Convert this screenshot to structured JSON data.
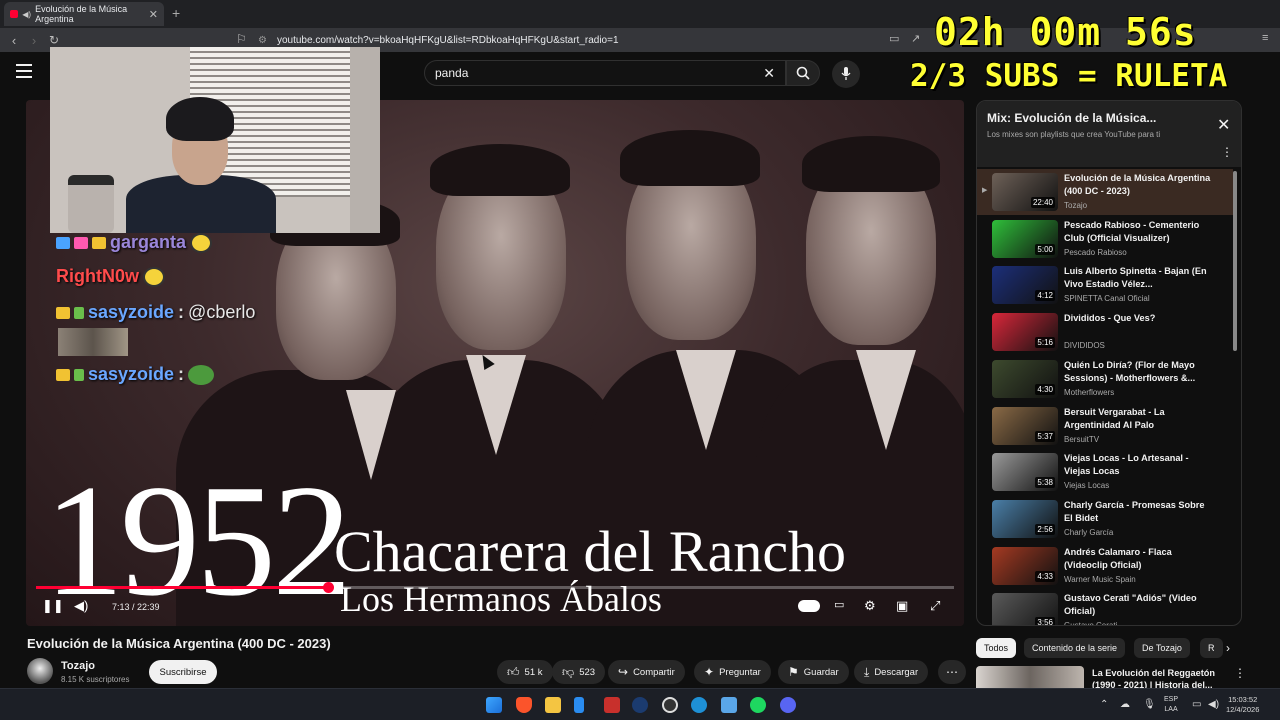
{
  "browser": {
    "tab_title": "Evolución de la Música Argentina",
    "url": "youtube.com/watch?v=bkoaHqHFKgU&list=RDbkoaHqHFKgU&start_radio=1"
  },
  "search": {
    "query": "panda"
  },
  "overlay": {
    "timer": "02h 00m 56s",
    "subs": "2/3 SUBS = RULETA"
  },
  "chat": [
    {
      "user": "garganta",
      "color": "#9a86d9",
      "message": ""
    },
    {
      "user": "RightN0w",
      "color": "#ff4b4b",
      "message": ""
    },
    {
      "user": "sasyzoide",
      "color": "#6aa7ff",
      "message": "@cberlo"
    },
    {
      "user": "sasyzoide",
      "color": "#6aa7ff",
      "message": ""
    }
  ],
  "video": {
    "year": "1952",
    "song": "Chacarera del Rancho",
    "artist": "Los Hermanos Ábalos",
    "time": "7:13 / 22:39",
    "progress": 0.318,
    "title": "Evolución de la Música Argentina (400 DC - 2023)"
  },
  "channel": {
    "name": "Tozajo",
    "subscribers": "8.15 K suscriptores",
    "subscribe_label": "Suscribirse"
  },
  "actions": {
    "likes": "51 k",
    "dislikes": "523",
    "share": "Compartir",
    "ask": "Preguntar",
    "save": "Guardar",
    "download": "Descargar"
  },
  "playlist": {
    "title": "Mix: Evolución de la Música...",
    "subtitle": "Los mixes son playlists que crea YouTube para ti",
    "items": [
      {
        "title": "Evolución de la Música Argentina (400 DC - 2023)",
        "channel": "Tozajo",
        "duration": "22:40",
        "thumb": "#6e6158",
        "current": true
      },
      {
        "title": "Pescado Rabioso - Cementerio Club (Official Visualizer)",
        "channel": "Pescado Rabioso",
        "duration": "5:00",
        "thumb": "#2fbf3a"
      },
      {
        "title": "Luis Alberto Spinetta - Bajan (En Vivo Estadio Vélez...",
        "channel": "SPINETTA Canal Oficial",
        "duration": "4:12",
        "thumb": "#1c2f7a"
      },
      {
        "title": "Divididos - Que Ves?",
        "channel": "DIVIDIDOS",
        "duration": "5:16",
        "thumb": "#d8273a"
      },
      {
        "title": "Quién Lo Diría? (Flor de Mayo Sessions) - Motherflowers &...",
        "channel": "Motherflowers",
        "duration": "4:30",
        "thumb": "#3d4a2e"
      },
      {
        "title": "Bersuit Vergarabat - La Argentinidad Al Palo",
        "channel": "BersuitTV",
        "duration": "5:37",
        "thumb": "#8a6a46"
      },
      {
        "title": "Viejas Locas - Lo Artesanal - Viejas Locas",
        "channel": "Viejas Locas",
        "duration": "5:38",
        "thumb": "#9a9a9a"
      },
      {
        "title": "Charly García - Promesas Sobre El Bidet",
        "channel": "Charly García",
        "duration": "2:56",
        "thumb": "#4a7fa8"
      },
      {
        "title": "Andrés Calamaro - Flaca (Videoclip Oficial)",
        "channel": "Warner Music Spain",
        "duration": "4:33",
        "thumb": "#a53a22"
      },
      {
        "title": "Gustavo Cerati \"Adiós\" (Video Oficial)",
        "channel": "Gustavo Cerati",
        "duration": "3:56",
        "thumb": "#5a5a5a"
      }
    ]
  },
  "chips": [
    "Todos",
    "Contenido de la serie",
    "De Tozajo",
    "R"
  ],
  "recommendation": {
    "title": "La Evolución del Reggaetón (1990 - 2021) | Historia del..."
  },
  "taskbar": {
    "lang1": "ESP",
    "lang2": "LAA",
    "time": "15:03:52",
    "date": "12/4/2026"
  }
}
